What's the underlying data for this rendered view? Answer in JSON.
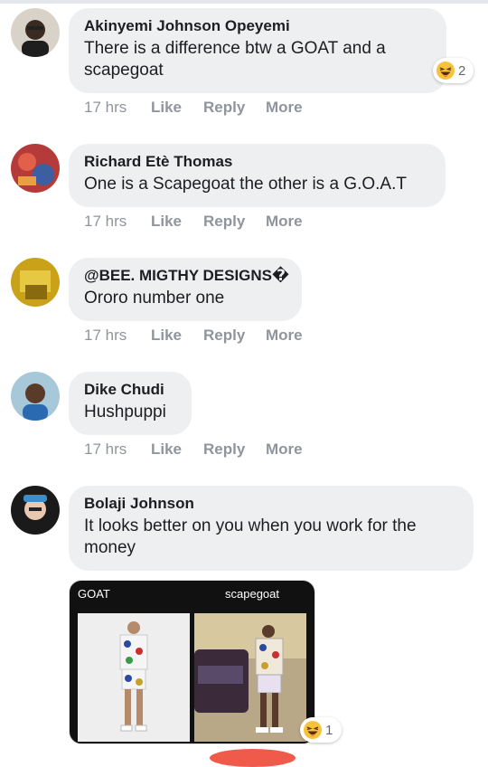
{
  "actions": {
    "like": "Like",
    "reply": "Reply",
    "more": "More"
  },
  "comments": [
    {
      "author": "Akinyemi Johnson Opeyemi",
      "text": "There is a difference btw a GOAT and a scapegoat",
      "time": "17 hrs",
      "reaction_count": "2",
      "reaction_icon": "laughing-emoji"
    },
    {
      "author": "Richard Etè Thomas",
      "text": "One is a Scapegoat the other is a G.O.A.T",
      "time": "17 hrs"
    },
    {
      "author": "@BEE. MIGTHY DESIGNS�",
      "text": "Ororo number one",
      "time": "17 hrs"
    },
    {
      "author": "Dike Chudi",
      "text": "Hushpuppi",
      "time": "17 hrs"
    },
    {
      "author": "Bolaji Johnson",
      "text": "It looks better on you when you work for the money",
      "reaction_count": "1",
      "reaction_icon": "laughing-emoji"
    }
  ],
  "attachment": {
    "label_left": "GOAT",
    "label_right": "scapegoat"
  },
  "colors": {
    "bubble": "#edeff1",
    "action_text": "#90949c",
    "accent": "#f05a4a"
  }
}
